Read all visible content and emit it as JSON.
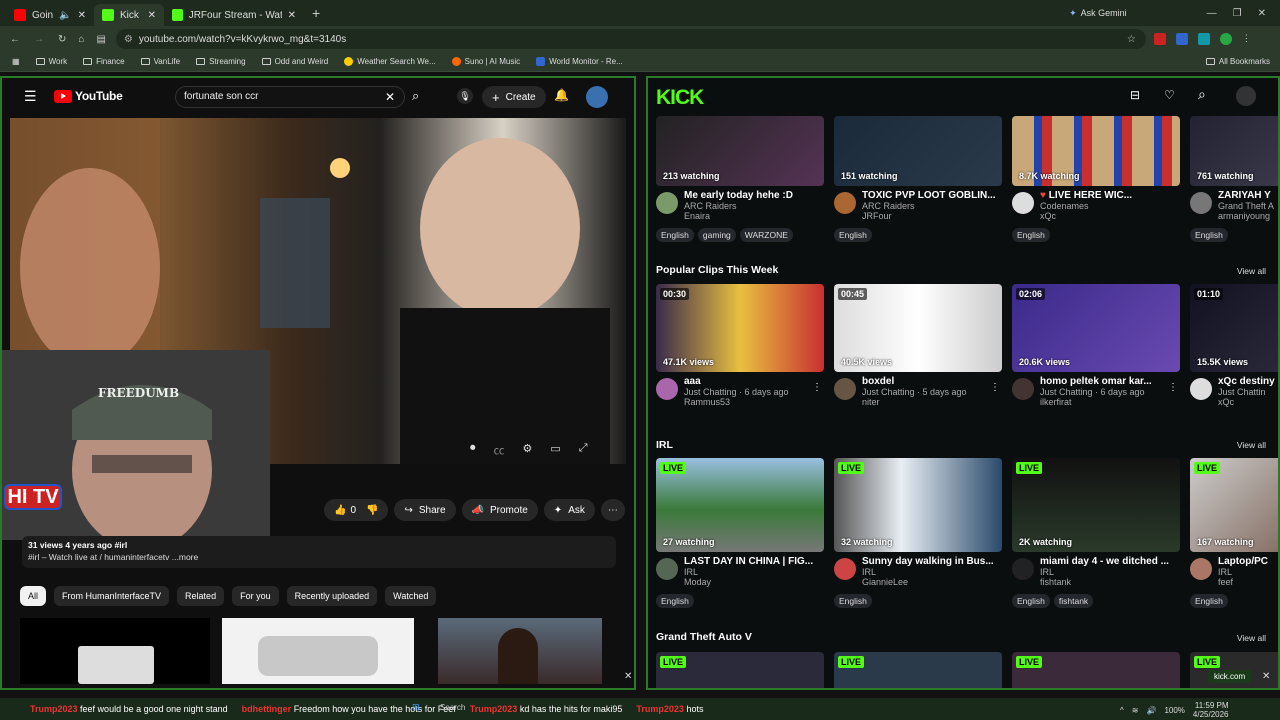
{
  "browser": {
    "tabs": [
      {
        "label": "Goin",
        "active": false
      },
      {
        "label": "Kick",
        "active": true
      },
      {
        "label": "JRFour Stream - Watch Live on",
        "active": false
      }
    ],
    "new_tab": "+",
    "ask_gemini": "Ask Gemini",
    "url": "youtube.com/watch?v=kKvykrwo_mg&t=3140s",
    "bookmarks": [
      "Work",
      "Finance",
      "VanLife",
      "Streaming",
      "Odd and Weird",
      "Weather Search We...",
      "Suno | AI Music",
      "World Monitor - Re..."
    ],
    "all_bookmarks": "All Bookmarks"
  },
  "youtube": {
    "logo": "YouTube",
    "search_value": "fortunate son ccr",
    "create_label": "Create",
    "video": {
      "overlay_logo": "HI TV",
      "cap_text": "FREEDUMB"
    },
    "like_count": "0",
    "share_label": "Share",
    "promote_label": "Promote",
    "ask_label": "Ask",
    "desc_meta": "31 views  4 years ago  #irl",
    "desc_line": "#irl – Watch live at  / humaninterfacetv  ...more",
    "chips": [
      "All",
      "From HumanInterfaceTV",
      "Related",
      "For you",
      "Recently uploaded",
      "Watched"
    ]
  },
  "kick": {
    "logo": "KICK",
    "row1": [
      {
        "watching": "213 watching",
        "title": "Me early today hehe :D",
        "category": "ARC Raiders",
        "user": "Enaira",
        "tags": [
          "English",
          "gaming",
          "WARZONE"
        ]
      },
      {
        "watching": "151 watching",
        "title": "TOXIC PVP LOOT GOBLIN...",
        "category": "ARC Raiders",
        "user": "JRFour",
        "tags": [
          "English"
        ]
      },
      {
        "watching": "8.7K watching",
        "title": "LIVE HERE WIC...",
        "category": "Codenames",
        "user": "xQc",
        "tags": [
          "English"
        ]
      },
      {
        "watching": "761 watching",
        "title": "ZARIYAH Y",
        "category": "Grand Theft A",
        "user": "armaniyoung",
        "tags": [
          "English"
        ]
      }
    ],
    "clips_section": "Popular Clips This Week",
    "view_all": "View all",
    "clips": [
      {
        "duration": "00:30",
        "views": "47.1K views",
        "title": "aaa",
        "meta": "Just Chatting · 6 days ago",
        "user": "Rammus53"
      },
      {
        "duration": "00:45",
        "views": "40.5K views",
        "title": "boxdel",
        "meta": "Just Chatting · 5 days ago",
        "user": "niter"
      },
      {
        "duration": "02:06",
        "views": "20.6K views",
        "title": "homo peltek omar kar...",
        "meta": "Just Chatting · 6 days ago",
        "user": "ilkerfirat"
      },
      {
        "duration": "01:10",
        "views": "15.5K views",
        "title": "xQc destiny",
        "meta": "Just Chattin",
        "user": "xQc"
      }
    ],
    "irl_section": "IRL",
    "irl": [
      {
        "live": "LIVE",
        "watching": "27 watching",
        "title": "LAST DAY IN CHINA | FIG...",
        "category": "IRL",
        "user": "Moday",
        "tags": [
          "English"
        ]
      },
      {
        "live": "LIVE",
        "watching": "32 watching",
        "title": "Sunny day walking in Bus...",
        "category": "IRL",
        "user": "GiannieLee",
        "tags": [
          "English"
        ]
      },
      {
        "live": "LIVE",
        "watching": "2K watching",
        "title": "miami day 4 - we ditched ...",
        "category": "IRL",
        "user": "fishtank",
        "tags": [
          "English",
          "fishtank"
        ]
      },
      {
        "live": "LIVE",
        "watching": "167 watching",
        "title": "Laptop/PC",
        "category": "IRL",
        "user": "feef",
        "tags": [
          "English"
        ]
      }
    ],
    "gta_section": "Grand Theft Auto V",
    "gta_live": [
      "LIVE",
      "LIVE",
      "LIVE",
      "LIVE"
    ],
    "url_chip": "kick.com"
  },
  "taskbar": {
    "ticker": [
      {
        "user": "Trump2023",
        "msg": "feef would be a good one night stand"
      },
      {
        "user": "bdhettinger",
        "msg": "Freedom how you have the hots for Feef"
      },
      {
        "user": "Trump2023",
        "msg": "kd has the hits for maki95"
      },
      {
        "user": "Trump2023",
        "msg": "hots"
      }
    ],
    "search": "Search",
    "battery": "100%",
    "time": "11:59 PM",
    "date": "4/25/2026"
  }
}
